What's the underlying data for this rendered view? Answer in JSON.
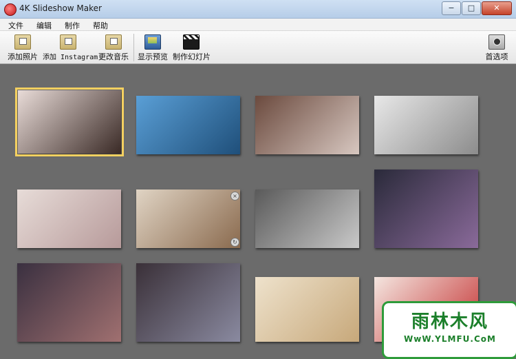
{
  "window": {
    "title": "4K Slideshow Maker"
  },
  "window_controls": {
    "minimize": "−",
    "maximize": "□",
    "close": "✕"
  },
  "menu": [
    "文件",
    "编辑",
    "制作",
    "帮助"
  ],
  "toolbar": {
    "add_photos": "添加照片",
    "add_instagram": "添加 Instagram",
    "change_music": "更改音乐",
    "preview": "显示预览",
    "make_slideshow": "制作幻灯片",
    "preferences": "首选项"
  },
  "icons": [
    "folder-photo-icon",
    "folder-instagram-icon",
    "folder-music-icon",
    "monitor-preview-icon",
    "clapperboard-icon",
    "camera-icon"
  ],
  "thumbnails": [
    {
      "colors": [
        "#e9dcd8",
        "#3a2a26"
      ],
      "selected": true
    },
    {
      "colors": [
        "#5a9fd6",
        "#1f4f7a"
      ]
    },
    {
      "colors": [
        "#6b4a3e",
        "#d7c7c0"
      ]
    },
    {
      "colors": [
        "#e8e8e8",
        "#8c8c8c"
      ]
    },
    {
      "colors": [
        "#e7dcd8",
        "#b79a9a"
      ]
    },
    {
      "colors": [
        "#e0d4c4",
        "#8a6a4e"
      ]
    },
    {
      "colors": [
        "#5a5a5a",
        "#c9c9c9"
      ]
    },
    {
      "colors": [
        "#2a2a3a",
        "#8a6a9a"
      ]
    },
    {
      "colors": [
        "#3a3040",
        "#a07070"
      ]
    },
    {
      "colors": [
        "#3a3038",
        "#8a8aa0"
      ]
    },
    {
      "colors": [
        "#eee2cc",
        "#c7a87a"
      ]
    },
    {
      "colors": [
        "#f4e6e0",
        "#c33030"
      ]
    }
  ],
  "watermark": {
    "title": "雨林木风",
    "url": "WwW.YLMFU.CoM"
  }
}
